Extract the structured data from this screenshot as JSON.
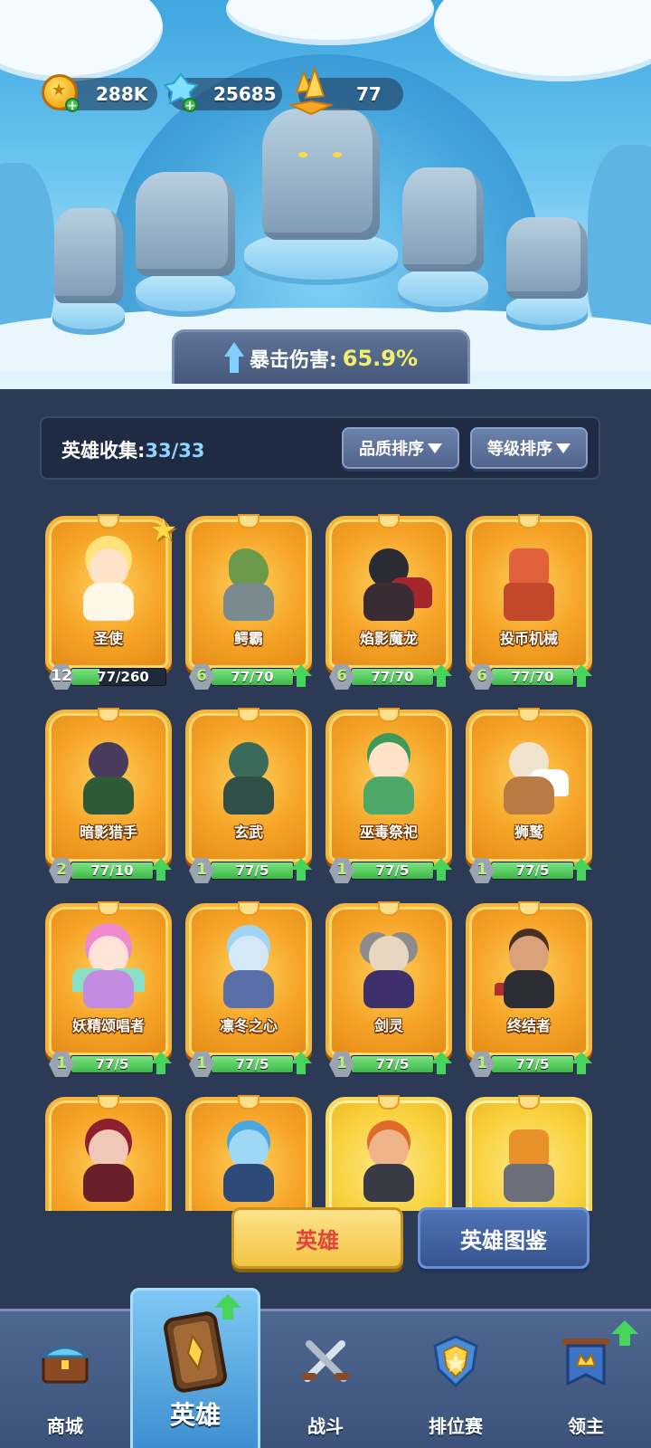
{
  "resources": {
    "gold": "288K",
    "diamonds": "25685",
    "crystals": "77"
  },
  "crit": {
    "label": "暴击伤害:",
    "value": "65.9%"
  },
  "collection": {
    "label": "英雄收集:",
    "count": "33/33",
    "sort_quality": "品质排序",
    "sort_level": "等级排序"
  },
  "heroes": [
    {
      "name": "圣使",
      "level": "12",
      "progress_text": "77/260",
      "progress": 0.3,
      "starred": true,
      "upgradable": false
    },
    {
      "name": "鳄霸",
      "level": "6",
      "progress_text": "77/70",
      "progress": 1.0,
      "upgradable": true
    },
    {
      "name": "焰影魔龙",
      "level": "6",
      "progress_text": "77/70",
      "progress": 1.0,
      "upgradable": true
    },
    {
      "name": "投币机械",
      "level": "6",
      "progress_text": "77/70",
      "progress": 1.0,
      "upgradable": true
    },
    {
      "name": "暗影猎手",
      "level": "2",
      "progress_text": "77/10",
      "progress": 1.0,
      "upgradable": true
    },
    {
      "name": "玄武",
      "level": "1",
      "progress_text": "77/5",
      "progress": 1.0,
      "upgradable": true
    },
    {
      "name": "巫毒祭祀",
      "level": "1",
      "progress_text": "77/5",
      "progress": 1.0,
      "upgradable": true
    },
    {
      "name": "狮鹫",
      "level": "1",
      "progress_text": "77/5",
      "progress": 1.0,
      "upgradable": true
    },
    {
      "name": "妖精颂唱者",
      "level": "1",
      "progress_text": "77/5",
      "progress": 1.0,
      "upgradable": true
    },
    {
      "name": "凛冬之心",
      "level": "1",
      "progress_text": "77/5",
      "progress": 1.0,
      "upgradable": true
    },
    {
      "name": "剑灵",
      "level": "1",
      "progress_text": "77/5",
      "progress": 1.0,
      "upgradable": true
    },
    {
      "name": "终结者",
      "level": "1",
      "progress_text": "77/5",
      "progress": 1.0,
      "upgradable": true
    }
  ],
  "tabs": {
    "hero": "英雄",
    "codex": "英雄图鉴"
  },
  "nav": {
    "shop": "商城",
    "hero": "英雄",
    "battle": "战斗",
    "ranked": "排位赛",
    "lord": "领主"
  },
  "colors": {
    "card_orange": "#f6a326",
    "card_gold": "#f8d13d",
    "progress_green": "#3bb84a",
    "crit_value": "#f2f06a",
    "hero_tab_text": "#e4423b"
  }
}
